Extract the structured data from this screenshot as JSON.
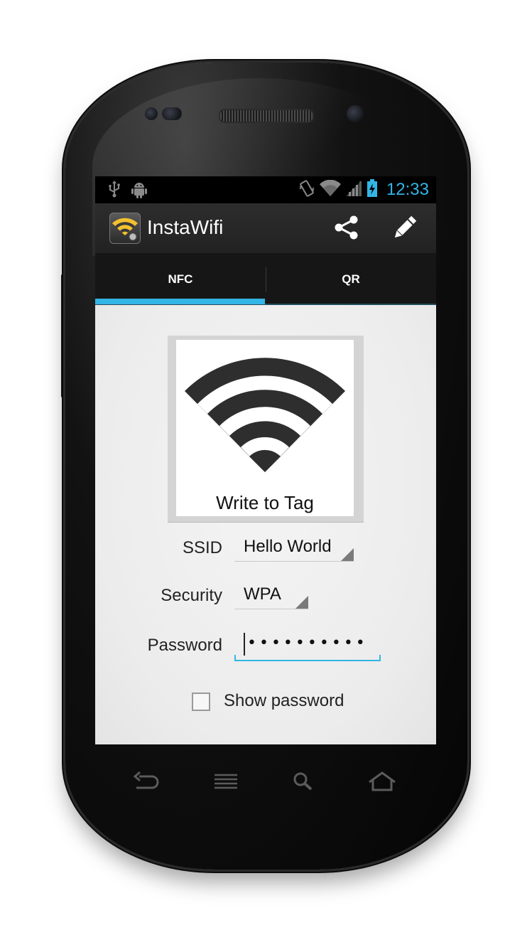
{
  "status_bar": {
    "time": "12:33",
    "icons": [
      "usb-icon",
      "android-debug-icon",
      "vibrate-icon",
      "wifi-icon",
      "signal-icon",
      "battery-charging-icon"
    ]
  },
  "action_bar": {
    "title": "InstaWifi",
    "actions": [
      "share-icon",
      "edit-icon"
    ]
  },
  "tabs": [
    {
      "label": "NFC",
      "selected": true
    },
    {
      "label": "QR",
      "selected": false
    }
  ],
  "tag_card": {
    "label": "Write to Tag",
    "icon": "wifi-large-icon"
  },
  "form": {
    "ssid_label": "SSID",
    "ssid_value": "Hello World",
    "security_label": "Security",
    "security_value": "WPA",
    "password_label": "Password",
    "password_mask": "••••••••••",
    "show_password_label": "Show password",
    "show_password_checked": false
  },
  "navigation": [
    "back-icon",
    "menu-icon",
    "search-icon",
    "home-icon"
  ],
  "colors": {
    "accent": "#33b5e5",
    "action_bar": "#2a2a2a",
    "content_background": "#efefef"
  }
}
